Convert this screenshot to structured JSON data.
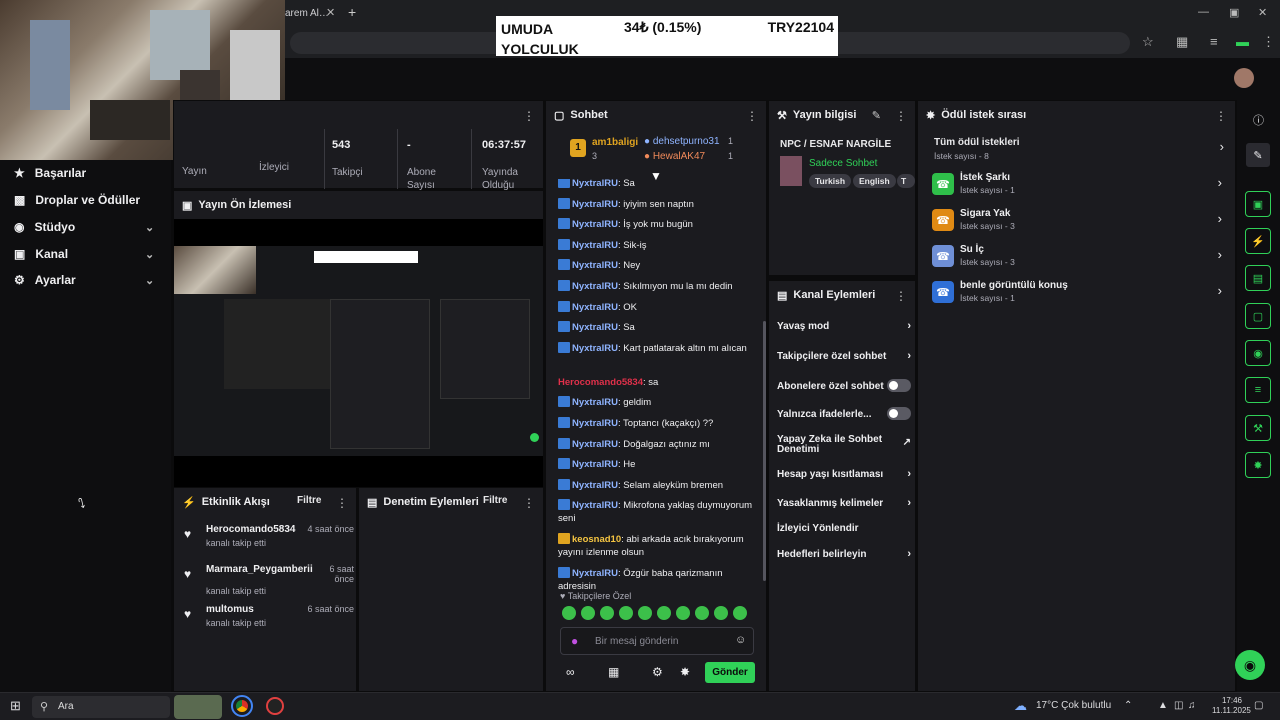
{
  "browser": {
    "tab_title": "arem Al…",
    "tab_close": "✕",
    "new_tab": "+"
  },
  "ticker": {
    "name_line1": "UMUDA",
    "name_line2": "YOLCULUK",
    "change": "34₺ (0.15%)",
    "price": "TRY22104"
  },
  "nav": {
    "items": [
      {
        "label": "Başarılar",
        "icon": "trophy-icon"
      },
      {
        "label": "Droplar ve Ödüller",
        "icon": "gift-icon"
      },
      {
        "label": "Stüdyo",
        "icon": "studio-icon"
      },
      {
        "label": "Kanal",
        "icon": "channel-icon"
      },
      {
        "label": "Ayarlar",
        "icon": "gear-icon"
      }
    ]
  },
  "stats": {
    "viewers_label": "İzleyici",
    "followers_value": "543",
    "followers_label": "Takipçi",
    "subs_value": "-",
    "subs_label1": "Abone",
    "subs_label2": "Sayısı",
    "uptime_value": "06:37:57",
    "uptime_label1": "Yayında",
    "uptime_label2": "Olduğu",
    "yayin_label": "Yayın"
  },
  "preview": {
    "title": "Yayın Ön İzlemesi"
  },
  "activity": {
    "title": "Etkinlik Akışı",
    "filter": "Filtre",
    "events": [
      {
        "name": "Herocomando5834",
        "desc": "kanalı takip etti",
        "time": "4 saat önce"
      },
      {
        "name": "Marmara_Peygamberii",
        "desc": "kanalı takip etti",
        "time1": "6 saat",
        "time2": "önce"
      },
      {
        "name": "multomus",
        "desc": "kanalı takip etti",
        "time": "6 saat önce"
      }
    ]
  },
  "moderation": {
    "title": "Denetim Eylemleri",
    "filter": "Filtre"
  },
  "chat": {
    "title": "Sohbet",
    "top_chatters": [
      {
        "rank": "1",
        "name": "am1baligi",
        "count": "3"
      },
      {
        "name": "dehsetpurno31",
        "count": "1"
      },
      {
        "name": "HewalAK47",
        "count": "1"
      }
    ],
    "messages": [
      {
        "user": "NyxtralRU",
        "text": ": Sa",
        "style": "u"
      },
      {
        "user": "NyxtralRU",
        "text": ": iyiyim sen naptın",
        "style": "u"
      },
      {
        "user": "NyxtralRU",
        "text": ": İş yok mu bugün",
        "style": "u"
      },
      {
        "user": "NyxtralRU",
        "text": ": Sik-iş",
        "style": "u"
      },
      {
        "user": "NyxtralRU",
        "text": ": Ney",
        "style": "u"
      },
      {
        "user": "NyxtralRU",
        "text": ": Sıkılmıyon mu la mı dedin",
        "style": "u"
      },
      {
        "user": "NyxtralRU",
        "text": ": OK",
        "style": "u"
      },
      {
        "user": "NyxtralRU",
        "text": ": Sa",
        "style": "u"
      },
      {
        "user": "NyxtralRU",
        "text": ": Kart patlatarak altın mı alıcan",
        "style": "u"
      },
      {
        "user": "Herocomando5834",
        "text": ": sa",
        "style": "u red"
      },
      {
        "user": "NyxtralRU",
        "text": ": geldim",
        "style": "u"
      },
      {
        "user": "NyxtralRU",
        "text": ": Toptancı (kaçakçı) ??",
        "style": "u"
      },
      {
        "user": "NyxtralRU",
        "text": ": Doğalgazı açtınız mı",
        "style": "u"
      },
      {
        "user": "NyxtralRU",
        "text": ": He",
        "style": "u"
      },
      {
        "user": "NyxtralRU",
        "text": ": Selam aleyküm bremen",
        "style": "u"
      },
      {
        "user": "NyxtralRU",
        "text": ": Mikrofona yaklaş duymuyorum seni",
        "style": "u"
      },
      {
        "user": "keosnad10",
        "text": ": abi arkada acık bırakıyorum yayını izlenme olsun",
        "style": "u gold"
      },
      {
        "user": "NyxtralRU",
        "text": ": Özgür baba qarizmanın adresisin",
        "style": "u"
      }
    ],
    "followers_only": "Takipçilere Özel",
    "placeholder": "Bir mesaj gönderin",
    "send": "Gönder"
  },
  "stream_info": {
    "title": "Yayın bilgisi",
    "stream_title": "NPC / ESNAF NARGİLE",
    "category": "Sadece Sohbet",
    "tags": [
      "Turkish",
      "English",
      "T"
    ]
  },
  "channel_actions": {
    "title": "Kanal Eylemleri",
    "items": [
      {
        "label": "Yavaş mod",
        "kind": "chev"
      },
      {
        "label": "Takipçilere özel sohbet",
        "kind": "chev"
      },
      {
        "label": "Abonelere özel sohbet",
        "kind": "toggle"
      },
      {
        "label": "Yalnızca ifadelerle...",
        "kind": "toggle"
      },
      {
        "label": "Yapay Zeka ile Sohbet Denetimi",
        "kind": "ext"
      },
      {
        "label": "Hesap yaşı kısıtlaması",
        "kind": "chev"
      },
      {
        "label": "Yasaklanmış kelimeler",
        "kind": "chev"
      },
      {
        "label": "İzleyici Yönlendir",
        "kind": "none"
      },
      {
        "label": "Hedefleri belirleyin",
        "kind": "chev"
      }
    ]
  },
  "rewards": {
    "title": "Ödül istek sırası",
    "all_label": "Tüm ödül istekleri",
    "all_count": "İstek sayısı - 8",
    "items": [
      {
        "name": "İstek Şarkı",
        "count": "İstek sayısı - 1",
        "color": "#2fbf4a"
      },
      {
        "name": "Sigara Yak",
        "count": "İstek sayısı - 3",
        "color": "#e08a14"
      },
      {
        "name": "Su İç",
        "count": "İstek sayısı - 3",
        "color": "#6f8fd6"
      },
      {
        "name": "benle görüntülü konuş",
        "count": "İstek sayısı - 1",
        "color": "#2f6fd6"
      }
    ]
  },
  "taskbar": {
    "search": "Ara",
    "weather": "17°C  Çok bulutlu",
    "time": "17:46",
    "date": "11.11.2025"
  }
}
